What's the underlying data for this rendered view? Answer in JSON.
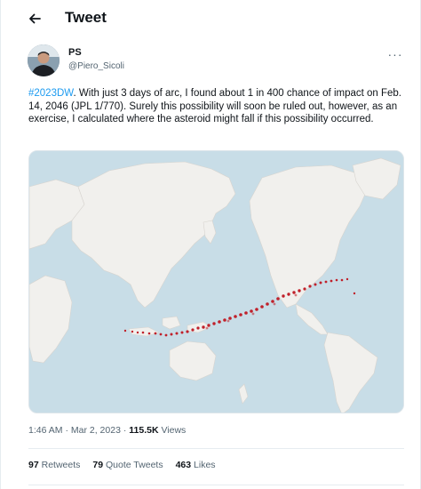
{
  "header": {
    "title": "Tweet",
    "back_icon": "arrow-left-icon"
  },
  "author": {
    "name": "PS",
    "handle": "@Piero_Sicoli",
    "avatar": "user-avatar"
  },
  "more_icon": "more-dots-icon",
  "tweet": {
    "hashtag": "#2023DW",
    "body": ". With just 3 days of arc, I found about 1 in 400 chance of impact on Feb. 14, 2046 (JPL 1/770). Surely this possibility will soon be ruled out, however, as an exercise, I calculated where the asteroid might fall if this possibility occurred."
  },
  "media": {
    "description_type": "world-map-with-impact-risk-corridor",
    "colors": {
      "ocean": "#c8dde7",
      "land": "#f1f0ed",
      "corridor": "#c0202a"
    }
  },
  "meta": {
    "time": "1:46 AM",
    "separator": " · ",
    "date": "Mar 2, 2023",
    "views_count": "115.5K",
    "views_label": " Views"
  },
  "stats": {
    "retweets_count": "97",
    "retweets_label": " Retweets",
    "quotes_count": "79",
    "quotes_label": " Quote Tweets",
    "likes_count": "463",
    "likes_label": " Likes"
  }
}
